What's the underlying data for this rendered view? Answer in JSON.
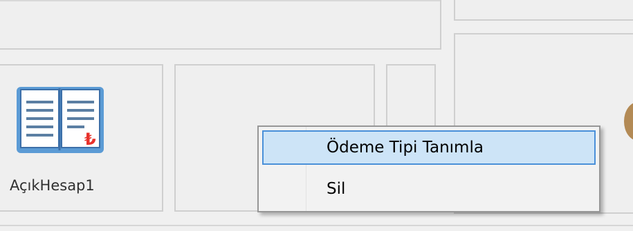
{
  "tile": {
    "label": "AçıkHesap1",
    "icon": "ledger-book-icon",
    "currency_glyph": "₺"
  },
  "context_menu": {
    "items": [
      {
        "label": "Ödeme Tipi Tanımla",
        "highlighted": true
      },
      {
        "label": "Sil",
        "highlighted": false
      }
    ]
  },
  "colors": {
    "background": "#f0f0f0",
    "tile_border": "#cfcfcf",
    "menu_highlight": "#cde4f7",
    "menu_highlight_border": "#4a90d9",
    "currency_red": "#e8312b",
    "book_cover": "#5b9bd5"
  }
}
